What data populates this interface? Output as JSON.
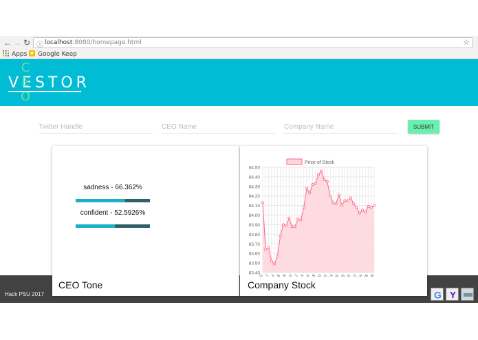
{
  "browser": {
    "url_host": "localhost",
    "url_rest": ":8080/homepage.html",
    "bookmarks": [
      {
        "label": "Apps",
        "icon": "apps-grid-icon"
      },
      {
        "label": "Google Keep",
        "icon": "google-keep-icon"
      }
    ]
  },
  "header": {
    "logo_word": "VESTOR",
    "logo_vertical": "CEO",
    "background_color": "#00bcd4",
    "accent_color": "#66e0a3"
  },
  "form": {
    "twitter_placeholder": "Twitter Handle",
    "ceo_placeholder": "CEO Name",
    "company_placeholder": "Company Name",
    "submit_label": "SUBMIT"
  },
  "tone_card": {
    "title": "CEO Tone",
    "tones": [
      {
        "label": "sadness - 66.362%",
        "value": 0.66362
      },
      {
        "label": "confident - 52.5926%",
        "value": 0.525926
      }
    ]
  },
  "stock_card": {
    "title": "Company Stock"
  },
  "footer": {
    "text": "Hack PSU 2017",
    "badges": [
      "google-icon",
      "yahoo-icon",
      "generic-logo-icon"
    ]
  },
  "chart_data": {
    "type": "area",
    "legend": [
      "Price of Stock"
    ],
    "series": [
      {
        "name": "Price of Stock",
        "values": [
          84.13,
          83.64,
          83.66,
          83.52,
          83.49,
          83.57,
          83.78,
          83.9,
          83.89,
          83.97,
          83.88,
          83.88,
          83.96,
          83.95,
          84.08,
          84.28,
          84.23,
          84.32,
          84.33,
          84.42,
          84.46,
          84.37,
          84.35,
          84.2,
          84.13,
          84.12,
          84.21,
          84.1,
          84.15,
          84.15,
          84.18,
          84.12,
          84.08,
          84.02,
          84.05,
          84.03,
          84.09,
          84.08,
          84.1
        ]
      }
    ],
    "x": [
      0,
      1,
      2,
      3,
      4,
      5,
      6,
      7,
      8,
      9,
      10,
      11,
      12,
      13,
      14,
      15,
      16,
      17,
      18,
      19,
      20,
      21,
      22,
      23,
      24,
      25,
      26,
      27,
      28,
      29,
      30,
      31,
      32,
      33,
      34,
      35,
      36,
      37,
      38
    ],
    "x_tick_labels": [
      "0",
      "2",
      "4",
      "6",
      "8",
      "10",
      "12",
      "14",
      "16",
      "18",
      "20",
      "22",
      "24",
      "26",
      "28",
      "30",
      "32",
      "34",
      "36",
      "38"
    ],
    "y_tick_labels": [
      "84.50",
      "84.40",
      "84.30",
      "84.20",
      "84.10",
      "84.00",
      "83.90",
      "83.80",
      "83.70",
      "83.60",
      "83.50",
      "83.40"
    ],
    "ylim": [
      83.4,
      84.5
    ],
    "grid": true,
    "legend_position": "top",
    "line_color": "#ff6384",
    "fill_color": "#ffd6dd"
  }
}
